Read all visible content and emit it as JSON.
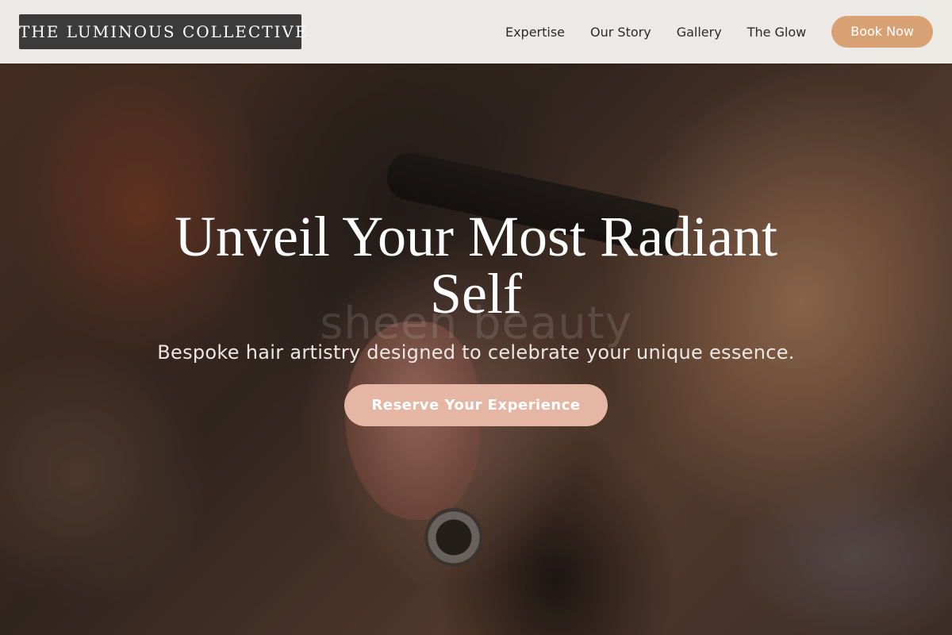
{
  "brand": {
    "name": "THE LUMINOUS COLLECTIVE"
  },
  "nav": {
    "links": [
      {
        "label": "Expertise"
      },
      {
        "label": "Our Story"
      },
      {
        "label": "Gallery"
      },
      {
        "label": "The Glow"
      }
    ],
    "cta_label": "Book Now"
  },
  "hero": {
    "title": "Unveil Your Most Radiant Self",
    "subtitle": "Bespoke hair artistry designed to celebrate your unique essence.",
    "cta_label": "Reserve Your Experience",
    "background_watermark": "sheen beauty"
  },
  "colors": {
    "header_bg": "#f4f1ee",
    "logo_bg": "#3b3b3b",
    "book_button": "#d7a173",
    "cta_button": "#e6b6a4",
    "text_dark": "#2b2b2b"
  }
}
